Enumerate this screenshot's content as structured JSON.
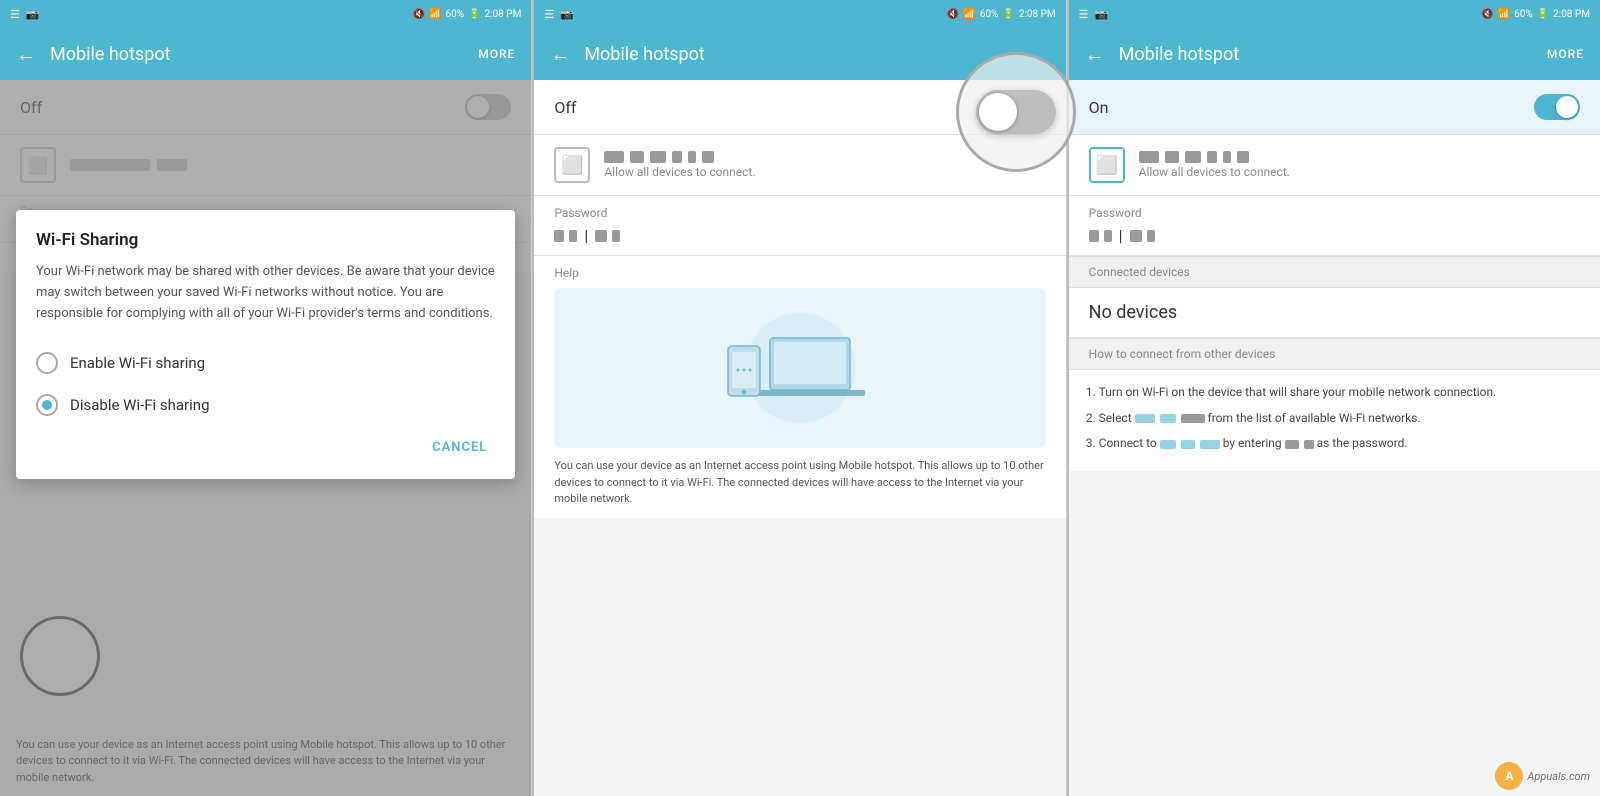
{
  "panels": [
    {
      "id": "panel1",
      "statusBar": {
        "left": [
          "☰",
          "📷"
        ],
        "right": [
          "🔇",
          "📶",
          "60%",
          "🔋",
          "2:08 PM"
        ]
      },
      "appBar": {
        "title": "Mobile hotspot",
        "moreLabel": "MORE",
        "backArrow": "←"
      },
      "toggle": {
        "label": "Off",
        "state": "off"
      },
      "dialog": {
        "title": "Wi-Fi Sharing",
        "body": "Your Wi-Fi network may be shared with other devices. Be aware that your device may switch between your saved Wi-Fi networks without notice. You are responsible for complying with all of your Wi-Fi provider's terms and conditions.",
        "options": [
          {
            "label": "Enable Wi-Fi sharing",
            "selected": false
          },
          {
            "label": "Disable Wi-Fi sharing",
            "selected": true
          }
        ],
        "cancelLabel": "CANCEL"
      },
      "footerText": "You can use your device as an Internet access point using Mobile hotspot. This allows up to 10 other devices to connect to it via Wi-Fi. The connected devices will have access to the Internet via your mobile network.",
      "hasCircleHighlight": true
    },
    {
      "id": "panel2",
      "statusBar": {
        "left": [
          "☰",
          "📷"
        ],
        "right": [
          "🔇",
          "📶",
          "60%",
          "🔋",
          "2:08 PM"
        ]
      },
      "appBar": {
        "title": "Mobile hotspot",
        "moreLabel": "",
        "backArrow": "←"
      },
      "toggle": {
        "label": "Off",
        "state": "off"
      },
      "networkRow": {
        "subLabel": "Allow all devices to connect."
      },
      "passwordLabel": "Password",
      "helpLabel": "Help",
      "helpText": "You can use your device as an Internet access point using Mobile hotspot. This allows up to 10 other devices to connect to it via Wi-Fi. The connected devices will have access to the Internet via your mobile network.",
      "hasCircleHighlight": true
    },
    {
      "id": "panel3",
      "statusBar": {
        "left": [
          "☰",
          "📷"
        ],
        "right": [
          "🔇",
          "📶",
          "60%",
          "🔋",
          "2:08 PM"
        ]
      },
      "appBar": {
        "title": "Mobile hotspot",
        "moreLabel": "MORE",
        "backArrow": "←"
      },
      "toggle": {
        "label": "On",
        "state": "on"
      },
      "networkRow": {
        "subLabel": "Allow all devices to connect."
      },
      "passwordLabel": "Password",
      "connectedDevicesLabel": "Connected devices",
      "noDevicesLabel": "No devices",
      "howToConnectLabel": "How to connect from other devices",
      "howToSteps": [
        "Turn on Wi-Fi on the device that will share your mobile network connection.",
        "Select ████ ██ from the list of available Wi-Fi networks.",
        "Connect to ████████ by entering ██ █ as the password."
      ]
    }
  ]
}
